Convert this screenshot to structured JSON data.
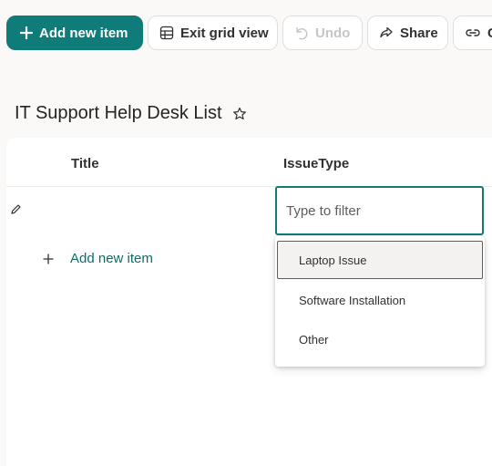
{
  "toolbar": {
    "add_label": "Add new item",
    "exit_grid_label": "Exit grid view",
    "undo_label": "Undo",
    "share_label": "Share",
    "copy_label": "C"
  },
  "list": {
    "title": "IT Support Help Desk List",
    "columns": [
      "Title",
      "IssueType"
    ],
    "add_row_label": "Add new item"
  },
  "filter": {
    "placeholder": "Type to filter",
    "options": [
      "Laptop Issue",
      "Software Installation",
      "Other"
    ],
    "highlighted_option": "Laptop Issue"
  },
  "colors": {
    "accent": "#107c7a",
    "accent_text": "#0f6b69",
    "background": "#faf9f8"
  }
}
